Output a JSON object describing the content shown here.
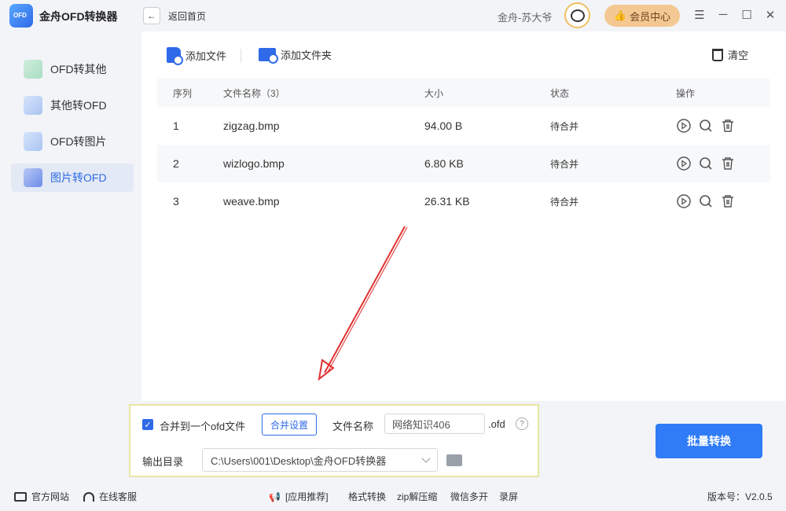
{
  "titlebar": {
    "app_title": "金舟OFD转换器",
    "back_label": "返回首页",
    "user_name": "金舟-苏大爷",
    "vip_label": "会员中心"
  },
  "sidebar": {
    "items": [
      {
        "label": "OFD转其他",
        "active": false
      },
      {
        "label": "其他转OFD",
        "active": false
      },
      {
        "label": "OFD转图片",
        "active": false
      },
      {
        "label": "图片转OFD",
        "active": true
      }
    ]
  },
  "toolbar": {
    "add_file": "添加文件",
    "add_folder": "添加文件夹",
    "clear": "清空"
  },
  "table": {
    "headers": {
      "seq": "序列",
      "name": "文件名称（3）",
      "size": "大小",
      "state": "状态",
      "action": "操作"
    },
    "rows": [
      {
        "seq": "1",
        "name": "zigzag.bmp",
        "size": "94.00 B",
        "state": "待合并"
      },
      {
        "seq": "2",
        "name": "wizlogo.bmp",
        "size": "6.80 KB",
        "state": "待合并"
      },
      {
        "seq": "3",
        "name": "weave.bmp",
        "size": "26.31 KB",
        "state": "待合并"
      }
    ]
  },
  "settings": {
    "merge_checked": true,
    "merge_label": "合并到一个ofd文件",
    "merge_settings_btn": "合并设置",
    "filename_label": "文件名称",
    "filename_value": "网络知识406",
    "ext": ".ofd",
    "help": "?",
    "output_label": "输出目录",
    "output_path": "C:\\Users\\001\\Desktop\\金舟OFD转换器"
  },
  "convert_btn": "批量转换",
  "footer": {
    "website": "官方网站",
    "support": "在线客服",
    "recommend": "[应用推荐]",
    "links": [
      "格式转换",
      "zip解压缩",
      "微信多开",
      "录屏"
    ],
    "version": "版本号：V2.0.5"
  },
  "colors": {
    "accent": "#2f7cf6",
    "vip": "#f4c892",
    "arrow": "#e03030"
  }
}
